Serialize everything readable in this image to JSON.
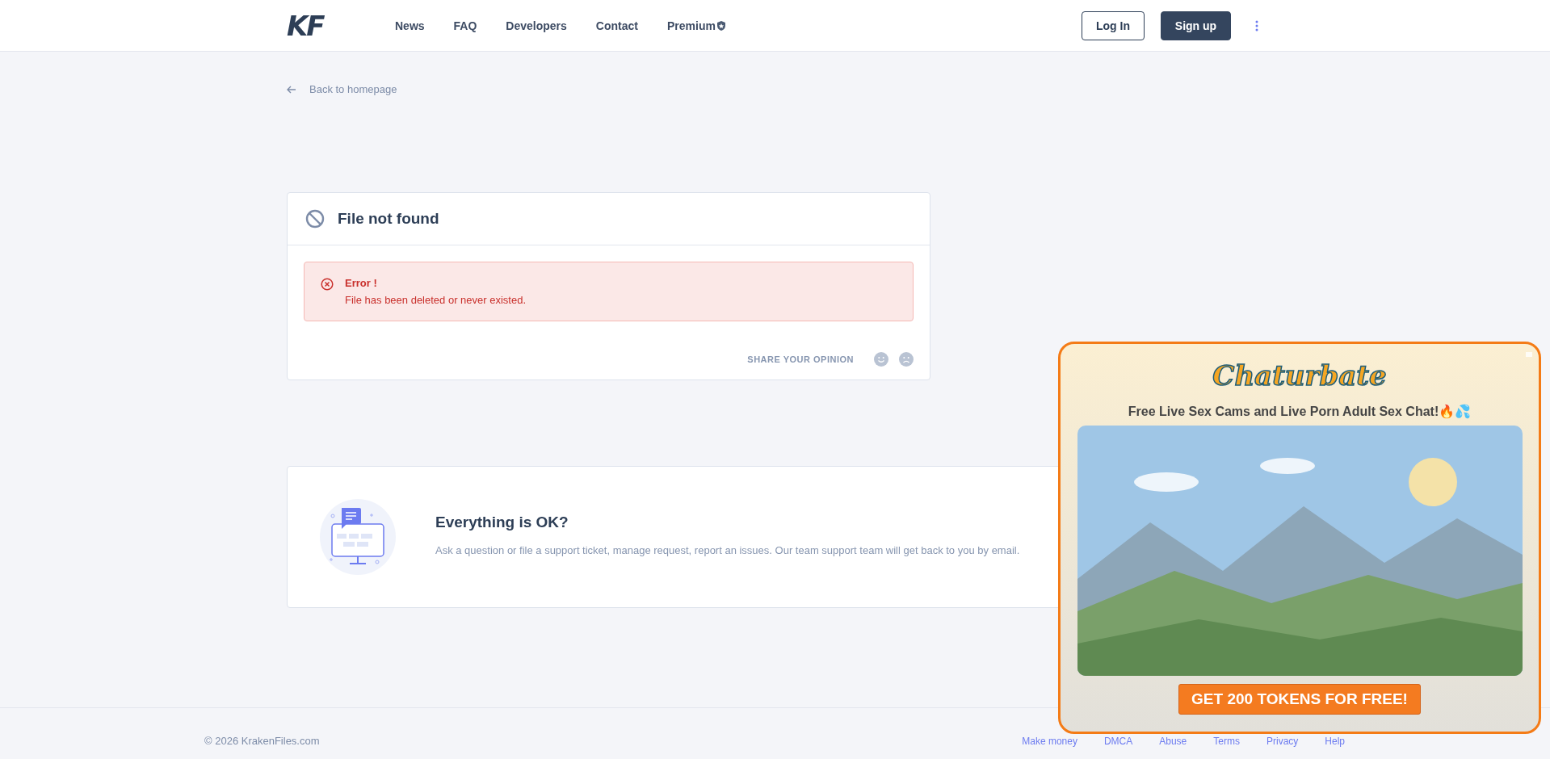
{
  "header": {
    "logo": "KF",
    "nav": [
      {
        "label": "News",
        "kind": "link"
      },
      {
        "label": "FAQ",
        "kind": "link"
      },
      {
        "label": "Developers",
        "kind": "link"
      },
      {
        "label": "Contact",
        "kind": "link"
      },
      {
        "label": "Premium",
        "kind": "premium"
      }
    ],
    "login": "Log In",
    "signup": "Sign up"
  },
  "back_link": "Back to homepage",
  "error_card": {
    "title": "File not found",
    "alert": {
      "title": "Error !",
      "message": "File has been deleted or never existed."
    },
    "opinion": "SHARE YOUR OPINION"
  },
  "support_card": {
    "title": "Everything is OK?",
    "text": "Ask a question or file a support ticket, manage request, report an issues. Our team support team will get back to you by email."
  },
  "footer": {
    "copyright": "© 2026 KrakenFiles.com",
    "links": [
      "Make money",
      "DMCA",
      "Abuse",
      "Terms",
      "Privacy",
      "Help"
    ]
  },
  "ad": {
    "logo": "Chaturbate",
    "tagline": "Free Live Sex Cams and Live Porn Adult Sex Chat!🔥💦",
    "cta": "GET 200 TOKENS FOR FREE!"
  }
}
